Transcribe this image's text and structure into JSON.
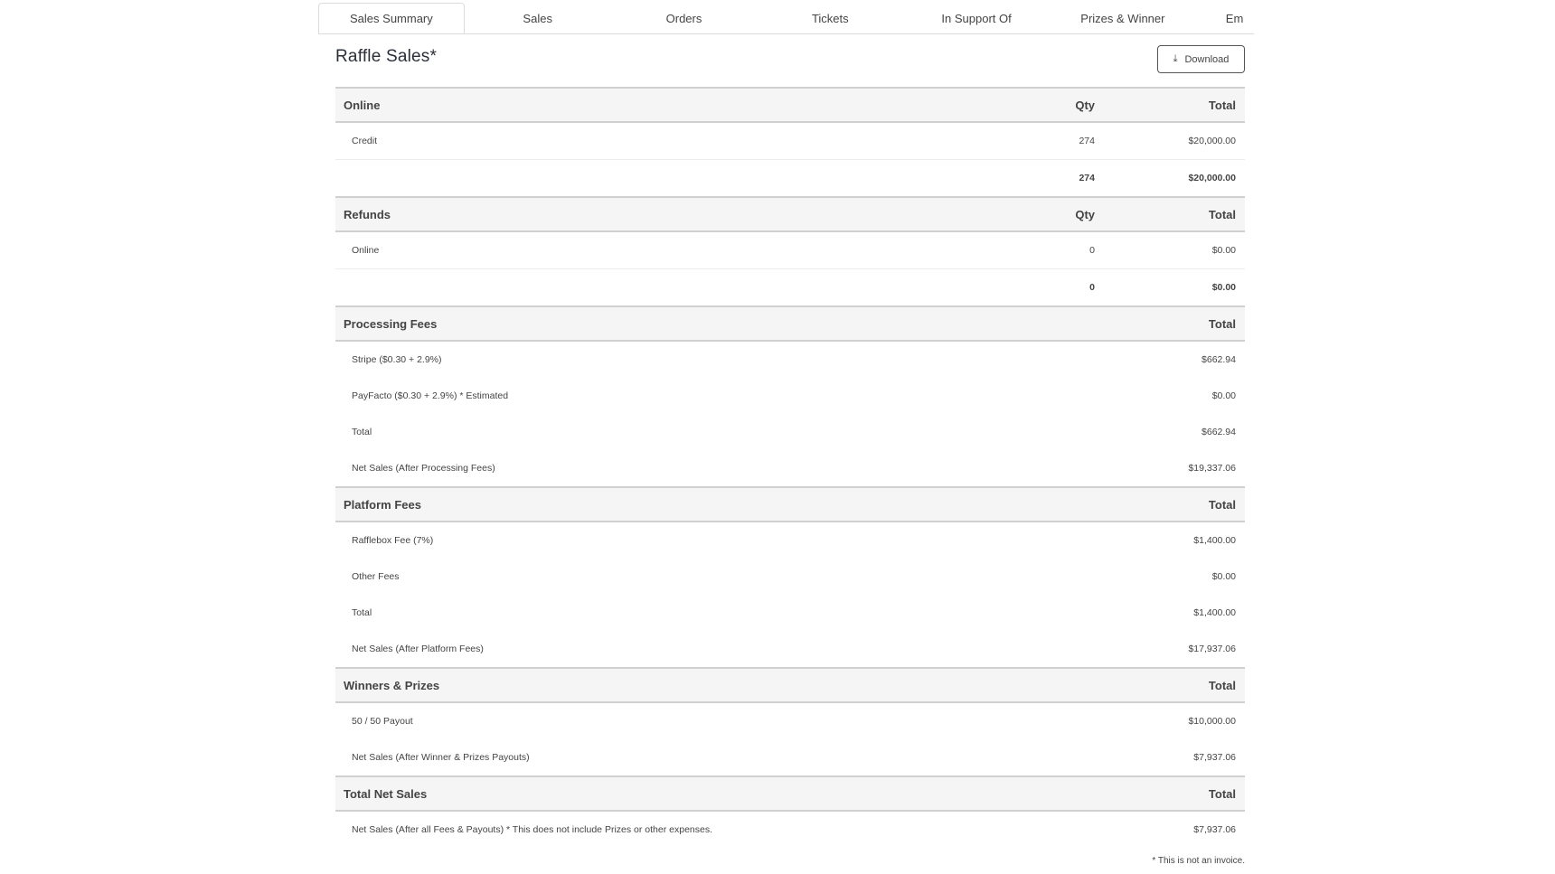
{
  "tabs": [
    {
      "label": "Sales Summary",
      "active": true
    },
    {
      "label": "Sales"
    },
    {
      "label": "Orders"
    },
    {
      "label": "Tickets"
    },
    {
      "label": "In Support Of"
    },
    {
      "label": "Prizes & Winner"
    },
    {
      "label": "Em"
    }
  ],
  "page": {
    "title": "Raffle Sales*",
    "download_label": "Download",
    "download_icon": "download-icon"
  },
  "online": {
    "header": "Online",
    "qty_header": "Qty",
    "total_header": "Total",
    "rows": [
      {
        "label": "Credit",
        "qty": "274",
        "total": "$20,000.00"
      }
    ],
    "subtotal": {
      "qty": "274",
      "total": "$20,000.00"
    }
  },
  "refunds": {
    "header": "Refunds",
    "qty_header": "Qty",
    "total_header": "Total",
    "rows": [
      {
        "label": "Online",
        "qty": "0",
        "total": "$0.00"
      }
    ],
    "subtotal": {
      "qty": "0",
      "total": "$0.00"
    }
  },
  "processing_fees": {
    "header": "Processing Fees",
    "total_header": "Total",
    "rows": [
      {
        "label": "Stripe ($0.30 + 2.9%)",
        "total": "$662.94"
      },
      {
        "label": "PayFacto ($0.30 + 2.9%) * Estimated",
        "total": "$0.00"
      },
      {
        "label": "Total",
        "total": "$662.94"
      },
      {
        "label": "Net Sales (After Processing Fees)",
        "total": "$19,337.06"
      }
    ]
  },
  "platform_fees": {
    "header": "Platform Fees",
    "total_header": "Total",
    "rows": [
      {
        "label": "Rafflebox Fee (7%)",
        "total": "$1,400.00"
      },
      {
        "label": "Other Fees",
        "total": "$0.00"
      },
      {
        "label": "Total",
        "total": "$1,400.00"
      },
      {
        "label": "Net Sales (After Platform Fees)",
        "total": "$17,937.06"
      }
    ]
  },
  "winners_prizes": {
    "header": "Winners & Prizes",
    "total_header": "Total",
    "rows": [
      {
        "label": "50 / 50 Payout",
        "total": "$10,000.00"
      },
      {
        "label": "Net Sales (After Winner & Prizes Payouts)",
        "total": "$7,937.06"
      }
    ]
  },
  "total_net_sales": {
    "header": "Total Net Sales",
    "total_header": "Total",
    "rows": [
      {
        "label": "Net Sales (After all Fees & Payouts) * This does not include Prizes or other expenses.",
        "total": "$7,937.06"
      }
    ]
  },
  "footnote": "* This is not an invoice."
}
